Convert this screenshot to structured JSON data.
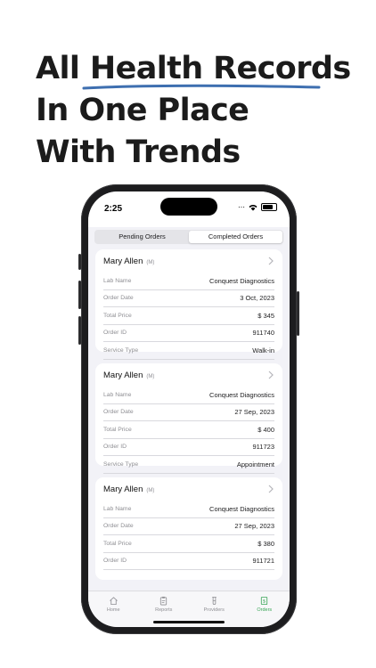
{
  "headline": {
    "line1_a": "All ",
    "line1_b": "Health Records",
    "line2": "In One Place",
    "line3": "With Trends"
  },
  "colors": {
    "accent_underline": "#3e6fb0",
    "tab_active": "#3aa657"
  },
  "status_bar": {
    "time": "2:25"
  },
  "segments": {
    "pending": "Pending Orders",
    "completed": "Completed Orders",
    "selected": "Completed Orders"
  },
  "labels": {
    "lab": "Lab Name",
    "date": "Order Date",
    "price": "Total Price",
    "id": "Order ID",
    "service": "Service Type"
  },
  "orders": [
    {
      "name": "Mary Allen",
      "tag": "(M)",
      "lab": "Conquest Diagnostics",
      "date": "3 Oct, 2023",
      "price": "$ 345",
      "id": "911740",
      "service": "Walk-in"
    },
    {
      "name": "Mary Allen",
      "tag": "(M)",
      "lab": "Conquest Diagnostics",
      "date": "27 Sep, 2023",
      "price": "$ 400",
      "id": "911723",
      "service": "Appointment"
    },
    {
      "name": "Mary Allen",
      "tag": "(M)",
      "lab": "Conquest Diagnostics",
      "date": "27 Sep, 2023",
      "price": "$ 380",
      "id": "911721",
      "service": ""
    }
  ],
  "tabs": [
    {
      "label": "Home",
      "icon": "home-icon"
    },
    {
      "label": "Reports",
      "icon": "clipboard-icon"
    },
    {
      "label": "Providers",
      "icon": "test-tube-icon"
    },
    {
      "label": "Orders",
      "icon": "receipt-dollar-icon"
    }
  ]
}
